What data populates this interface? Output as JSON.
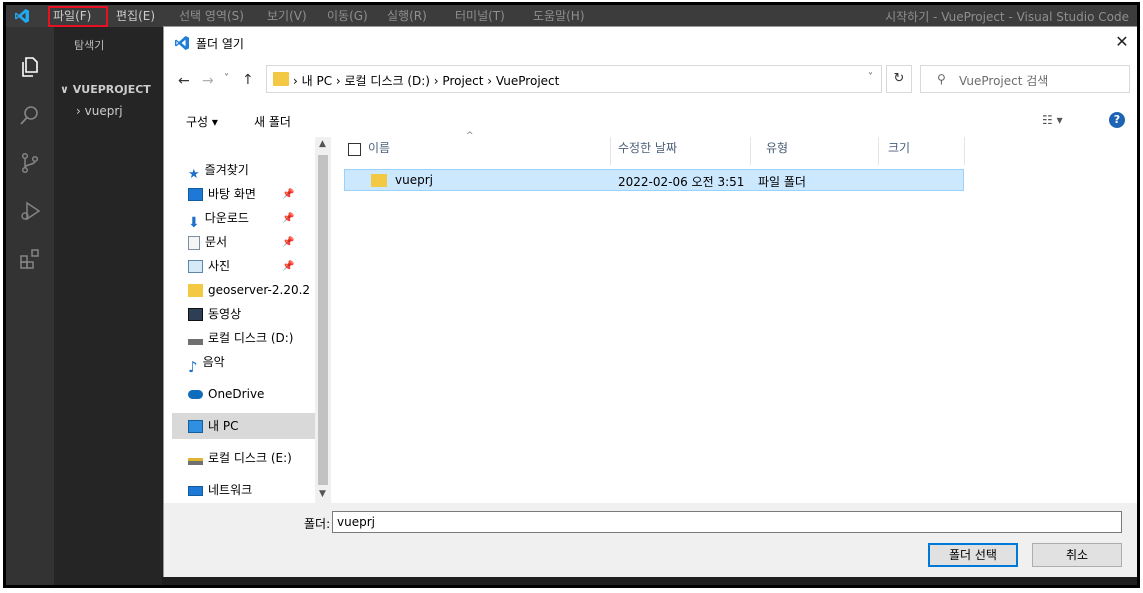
{
  "vscode": {
    "menu": {
      "file": "파일(F)",
      "edit": "편집(E)",
      "selection": "선택 영역(S)",
      "view": "보기(V)",
      "go": "이동(G)",
      "run": "실행(R)",
      "terminal": "터미널(T)",
      "help": "도움말(H)"
    },
    "window_title": "시작하기 - VueProject - Visual Studio Code",
    "sidebar": {
      "title": "탐색기",
      "project": "VUEPROJECT",
      "folder": "vueprj"
    },
    "highlight_color": "#e81123"
  },
  "dialog": {
    "title": "폴더 열기",
    "address": {
      "path": "› 내 PC › 로컬 디스크 (D:) › Project › VueProject"
    },
    "search": {
      "placeholder": "VueProject 검색"
    },
    "toolbar": {
      "organize": "구성 ▾",
      "new_folder": "새 폴더"
    },
    "nav": {
      "quick_access": "즐겨찾기",
      "desktop": "바탕 화면",
      "downloads": "다운로드",
      "documents": "문서",
      "pictures": "사진",
      "geoserver": "geoserver-2.20.2",
      "videos": "동영상",
      "local_disk_d": "로컬 디스크 (D:)",
      "music": "음악",
      "onedrive": "OneDrive",
      "this_pc": "내 PC",
      "local_disk_e": "로컬 디스크 (E:)",
      "network": "네트워크"
    },
    "columns": {
      "name": "이름",
      "date": "수정한 날짜",
      "type": "유형",
      "size": "크기"
    },
    "files": [
      {
        "name": "vueprj",
        "date": "2022-02-06 오전 3:51",
        "type": "파일 폴더"
      }
    ],
    "folder_label": "폴더:",
    "folder_value": "vueprj",
    "select_button": "폴더 선택",
    "cancel_button": "취소",
    "accent_color": "#0078d7"
  }
}
